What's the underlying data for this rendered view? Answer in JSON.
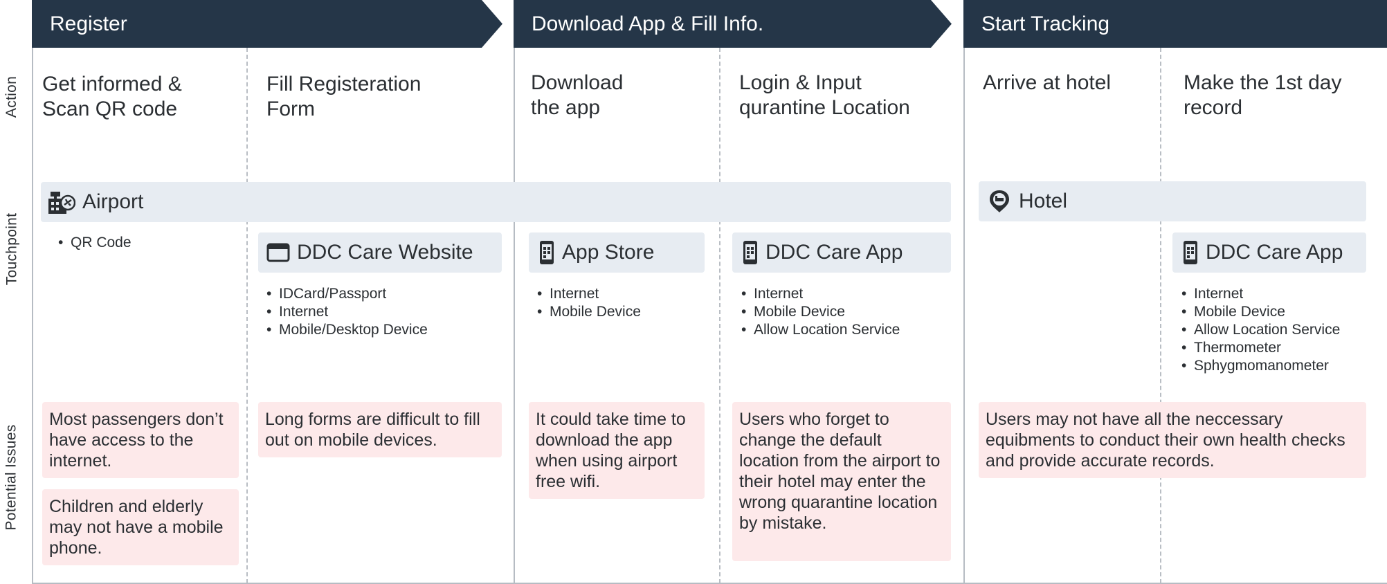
{
  "rows": {
    "action": "Action",
    "touchpoint": "Touchpoint",
    "issues": "Potential Issues"
  },
  "phases": [
    {
      "label": "Register"
    },
    {
      "label": "Download App & Fill Info."
    },
    {
      "label": "Start Tracking"
    }
  ],
  "actions": [
    "Get informed &\nScan QR code",
    "Fill Registeration\nForm",
    "Download\nthe app",
    "Login & Input\nqurantine Location",
    "Arrive at hotel",
    "Make the 1st day\nrecord"
  ],
  "touchpoints": {
    "airport": {
      "label": "Airport",
      "icon": "airport-icon",
      "items": [
        "QR Code"
      ]
    },
    "hotel": {
      "label": "Hotel",
      "icon": "hotel-pin-icon"
    },
    "website": {
      "label": "DDC Care Website",
      "icon": "browser-window-icon",
      "items": [
        "IDCard/Passport",
        "Internet",
        "Mobile/Desktop Device"
      ]
    },
    "app_store": {
      "label": "App Store",
      "icon": "mobile-phone-icon",
      "items": [
        "Internet",
        "Mobile Device"
      ]
    },
    "ddc_app_1": {
      "label": "DDC Care App",
      "icon": "mobile-phone-icon",
      "items": [
        "Internet",
        "Mobile Device",
        "Allow Location Service"
      ]
    },
    "ddc_app_2": {
      "label": "DDC Care App",
      "icon": "mobile-phone-icon",
      "items": [
        "Internet",
        "Mobile Device",
        "Allow Location Service",
        "Thermometer",
        "Sphygmomanometer"
      ]
    }
  },
  "issues": [
    "Most passengers don’t have access to the internet.",
    "Children and elderly may not have a mobile phone.",
    "Long forms are difficult to fill out on mobile devices.",
    "It could take time to download the app when using airport free wifi.",
    "Users who forget to change the default location from the airport to their hotel may enter the wrong quarantine location by mistake.",
    "Users may not have all the neccessary equibments to conduct their own health checks and provide accurate records."
  ],
  "colors": {
    "header": "#253648",
    "touchpoint_bar": "#e7ecf2",
    "issue_box": "#fde9ea"
  }
}
